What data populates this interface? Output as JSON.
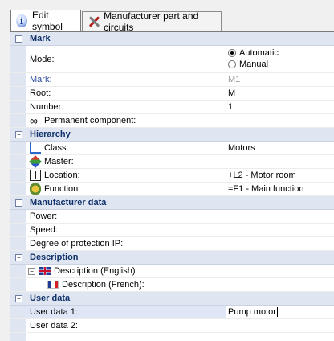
{
  "tabs": [
    {
      "label": "Edit symbol",
      "icon": "info-icon",
      "active": true
    },
    {
      "label": "Manufacturer part and circuits",
      "icon": "tools-icon",
      "active": false
    }
  ],
  "sections": {
    "mark": {
      "title": "Mark",
      "mode_label": "Mode:",
      "mode_options": [
        "Automatic",
        "Manual"
      ],
      "mode_selected": "Automatic",
      "mark_label": "Mark:",
      "mark_value": "M1",
      "root_label": "Root:",
      "root_value": "M",
      "number_label": "Number:",
      "number_value": "1",
      "permanent_label": "Permanent component:",
      "permanent_checked": false
    },
    "hierarchy": {
      "title": "Hierarchy",
      "class_label": "Class:",
      "class_value": "Motors",
      "master_label": "Master:",
      "master_value": "",
      "location_label": "Location:",
      "location_value": "+L2 - Motor room",
      "function_label": "Function:",
      "function_value": "=F1 - Main function"
    },
    "manufacturer": {
      "title": "Manufacturer data",
      "power_label": "Power:",
      "speed_label": "Speed:",
      "ip_label": "Degree of protection IP:"
    },
    "description": {
      "title": "Description",
      "english_label": "Description (English)",
      "french_label": "Description (French):"
    },
    "user_data": {
      "title": "User data",
      "ud1_label": "User data 1:",
      "ud1_value": "Pump motor",
      "ud2_label": "User data 2:",
      "ud2_value": ""
    }
  },
  "expander_symbol": "−",
  "infinity_symbol": "∞"
}
